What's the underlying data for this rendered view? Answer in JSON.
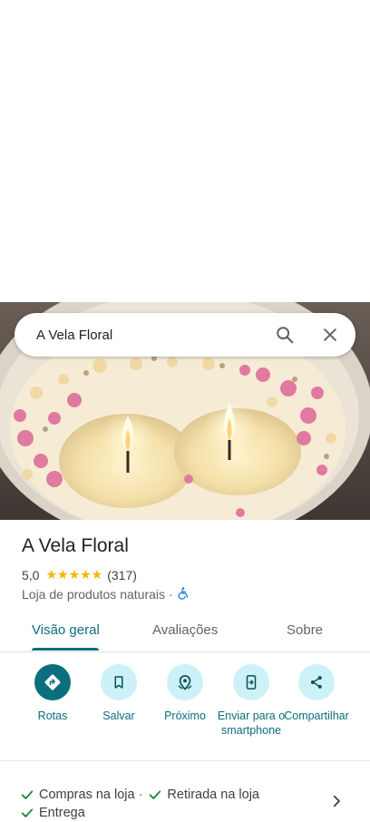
{
  "search": {
    "query": "A Vela Floral"
  },
  "place": {
    "name": "A Vela Floral",
    "rating": "5,0",
    "stars": "★★★★★",
    "review_count": "(317)",
    "category": "Loja de produtos naturais",
    "separator": "·"
  },
  "tabs": [
    {
      "label": "Visão geral",
      "active": true
    },
    {
      "label": "Avaliações",
      "active": false
    },
    {
      "label": "Sobre",
      "active": false
    }
  ],
  "actions": [
    {
      "label": "Rotas",
      "icon": "directions-icon"
    },
    {
      "label": "Salvar",
      "icon": "bookmark-icon"
    },
    {
      "label": "Próximo",
      "icon": "nearby-icon"
    },
    {
      "label": "Enviar para o smartphone",
      "icon": "send-to-phone-icon"
    },
    {
      "label": "Compartilhar",
      "icon": "share-icon"
    }
  ],
  "services": {
    "items": [
      "Compras na loja",
      "Retirada na loja",
      "Entrega"
    ],
    "separator": "·"
  },
  "colors": {
    "accent": "#0b6e7c",
    "accent_light": "#ccf2f7",
    "star": "#f4b400",
    "check": "#188038"
  }
}
